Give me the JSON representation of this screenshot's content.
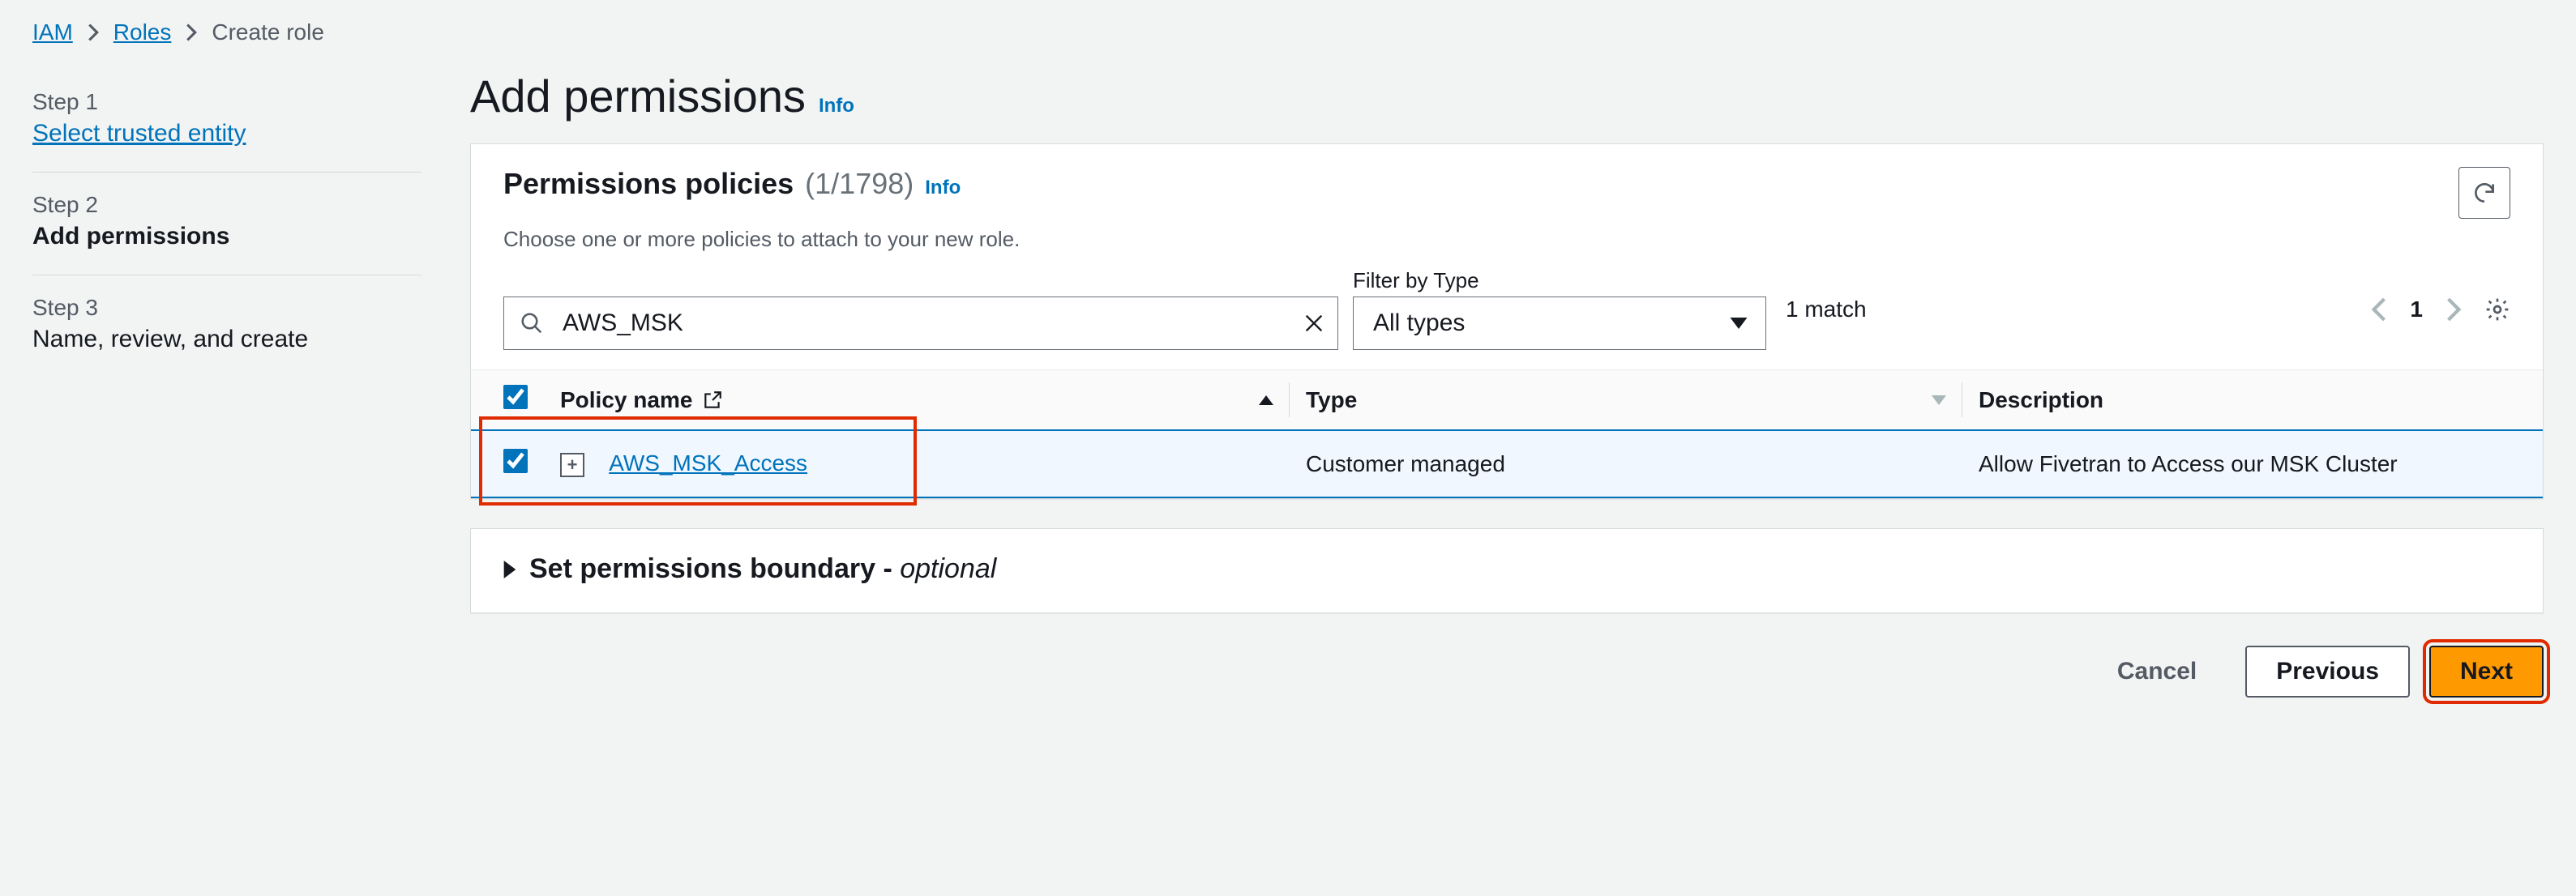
{
  "breadcrumb": {
    "items": [
      "IAM",
      "Roles",
      "Create role"
    ]
  },
  "steps": {
    "s1_label": "Step 1",
    "s1_title": "Select trusted entity",
    "s2_label": "Step 2",
    "s2_title": "Add permissions",
    "s3_label": "Step 3",
    "s3_title": "Name, review, and create"
  },
  "header": {
    "title": "Add permissions",
    "info": "Info"
  },
  "policies_card": {
    "title": "Permissions policies",
    "count": "(1/1798)",
    "info": "Info",
    "subtitle": "Choose one or more policies to attach to your new role."
  },
  "search": {
    "value": "AWS_MSK"
  },
  "filter": {
    "label": "Filter by Type",
    "selected": "All types"
  },
  "match_text": "1 match",
  "pagination": {
    "page": "1"
  },
  "columns": {
    "name": "Policy name",
    "type": "Type",
    "description": "Description"
  },
  "rows": [
    {
      "name": "AWS_MSK_Access",
      "type": "Customer managed",
      "description": "Allow Fivetran to Access our MSK Cluster",
      "checked": true
    }
  ],
  "boundary": {
    "label_main": "Set permissions boundary - ",
    "label_opt": "optional"
  },
  "buttons": {
    "cancel": "Cancel",
    "previous": "Previous",
    "next": "Next"
  }
}
